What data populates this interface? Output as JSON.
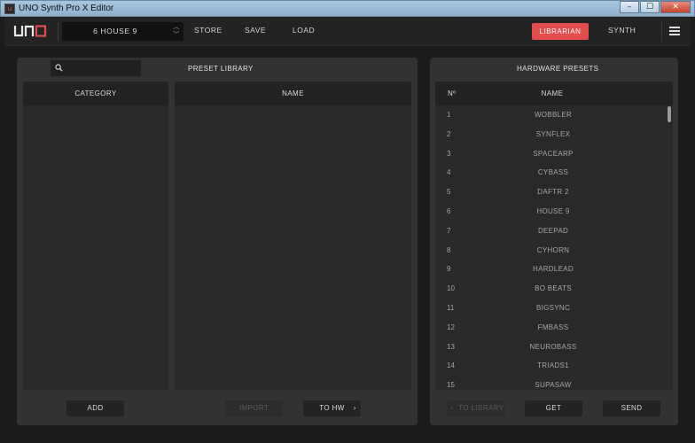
{
  "window": {
    "title": "UNO Synth Pro X Editor",
    "controls": [
      "–",
      "☐",
      "✕"
    ]
  },
  "toolbar": {
    "logo": "UNO",
    "preset_name": "6 HOUSE  9",
    "store_label": "STORE",
    "save_label": "SAVE",
    "load_label": "LOAD",
    "librarian_label": "LIBRARIAN",
    "synth_label": "SYNTH"
  },
  "preset_library": {
    "title": "PRESET LIBRARY",
    "search_placeholder": "",
    "category_header": "CATEGORY",
    "name_header": "NAME",
    "add_label": "ADD",
    "import_label": "IMPORT",
    "to_hw_label": "TO HW"
  },
  "hardware_presets": {
    "title": "HARDWARE PRESETS",
    "num_header": "Nº",
    "name_header": "NAME",
    "rows": [
      {
        "num": "1",
        "name": "WOBBLER"
      },
      {
        "num": "2",
        "name": "SYNFLEX"
      },
      {
        "num": "3",
        "name": "SPACEARP"
      },
      {
        "num": "4",
        "name": "CYBASS"
      },
      {
        "num": "5",
        "name": "DAFTR 2"
      },
      {
        "num": "6",
        "name": "HOUSE  9"
      },
      {
        "num": "7",
        "name": "DEEPAD"
      },
      {
        "num": "8",
        "name": "CYHORN"
      },
      {
        "num": "9",
        "name": "HARDLEAD"
      },
      {
        "num": "10",
        "name": "BO BEATS"
      },
      {
        "num": "11",
        "name": "BIGSYNC"
      },
      {
        "num": "12",
        "name": "FMBASS"
      },
      {
        "num": "13",
        "name": "NEUROBASS"
      },
      {
        "num": "14",
        "name": "TRIADS1"
      },
      {
        "num": "15",
        "name": "SUPASAW"
      }
    ],
    "to_library_label": "TO LIBRARY",
    "get_label": "GET",
    "send_label": "SEND"
  },
  "colors": {
    "accent": "#e14d4d",
    "background": "#1b1b1b",
    "panel": "#323232"
  }
}
